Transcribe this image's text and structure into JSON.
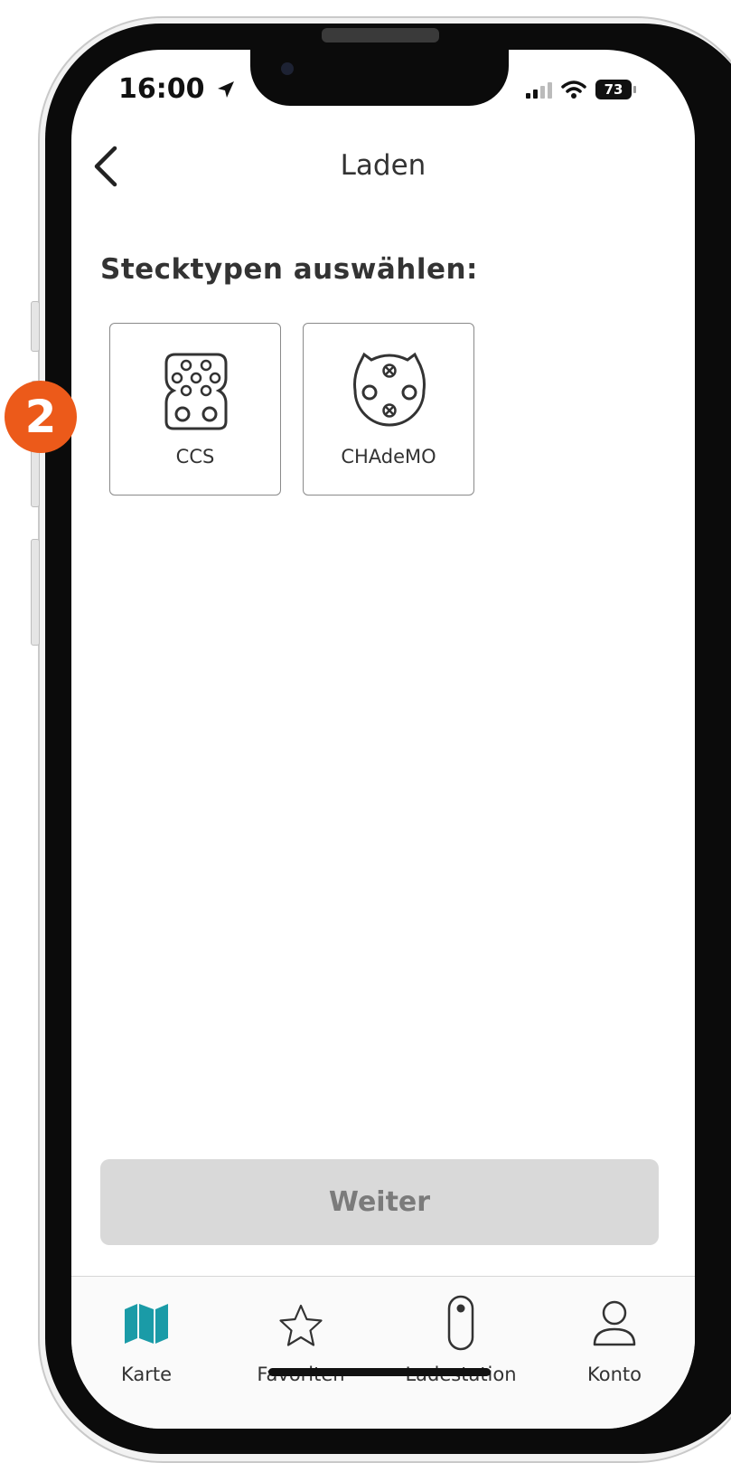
{
  "status_bar": {
    "time": "16:00",
    "battery": "73"
  },
  "header": {
    "title": "Laden"
  },
  "section_heading": "Stecktypen auswählen:",
  "plug_types": [
    {
      "label": "CCS",
      "icon": "ccs-connector-icon"
    },
    {
      "label": "CHAdeMO",
      "icon": "chademo-connector-icon"
    }
  ],
  "next_button": {
    "label": "Weiter",
    "state": "disabled"
  },
  "tab_bar": {
    "items": [
      {
        "label": "Karte",
        "icon": "map-icon",
        "active": true
      },
      {
        "label": "Favoriten",
        "icon": "star-icon",
        "active": false
      },
      {
        "label": "Ladestation",
        "icon": "charging-station-icon",
        "active": false
      },
      {
        "label": "Konto",
        "icon": "user-icon",
        "active": false
      }
    ]
  },
  "step_badge": "2",
  "colors": {
    "accent": "#1a9ba7",
    "badge": "#ec5a1a",
    "button_disabled": "#d9d9d9"
  }
}
